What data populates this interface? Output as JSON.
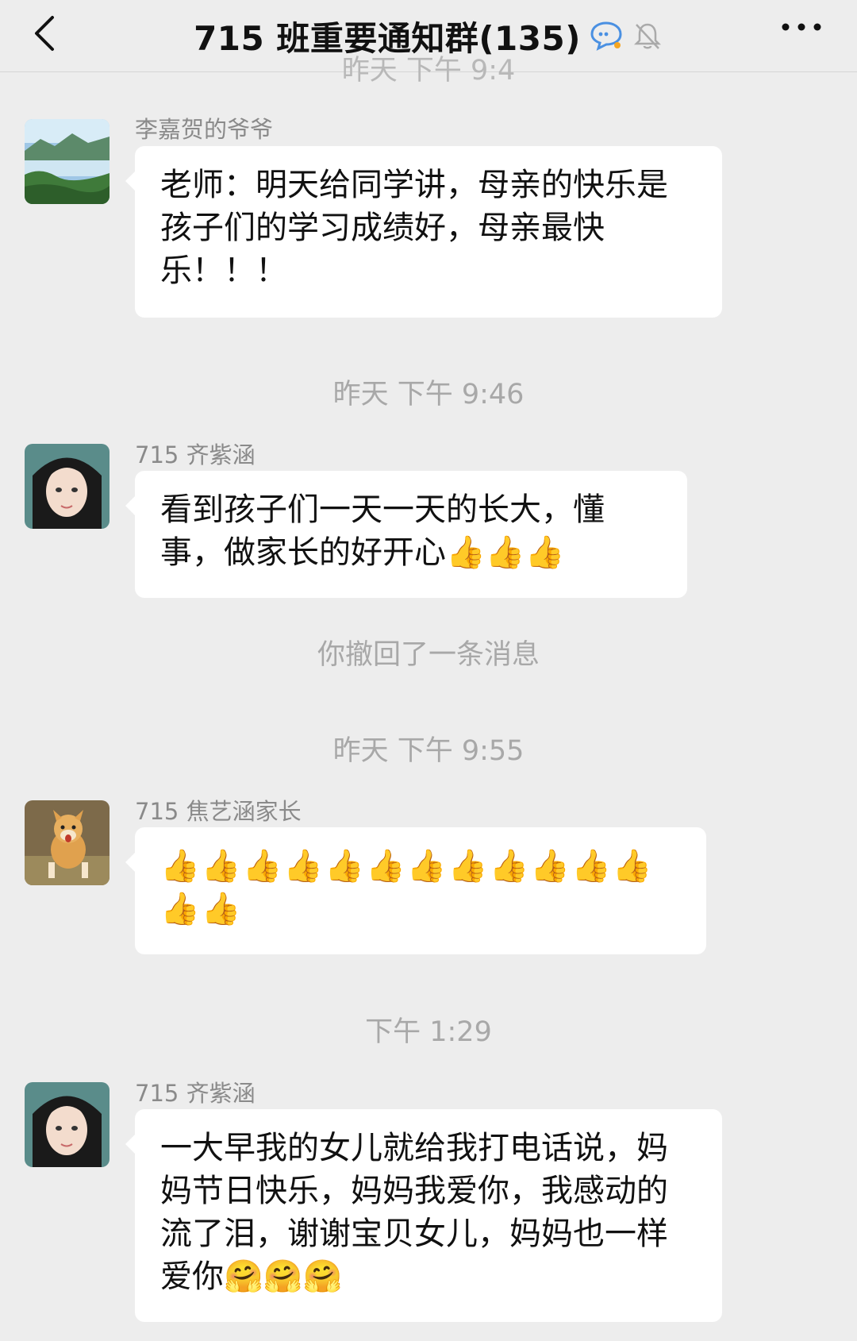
{
  "header": {
    "title": "715 班重要通知群(135)",
    "back_icon": "chevron-left-icon",
    "more_icon": "more-dots-icon",
    "chat_icon": "chat-bubble-icon",
    "mute_icon": "bell-off-icon"
  },
  "timestamps": {
    "top_peek": "昨天 下午 9:4",
    "t1": "昨天 下午 9:46",
    "recall": "你撤回了一条消息",
    "t2": "昨天 下午 9:55",
    "t3": "下午 1:29"
  },
  "messages": [
    {
      "sender": "李嘉贺的爷爷",
      "text": "老师：明天给同学讲，母亲的快乐是孩子们的学习成绩好，母亲最快乐！！！"
    },
    {
      "sender": "715 齐紫涵",
      "text": "看到孩子们一天一天的长大，懂事，做家长的好开心👍👍👍"
    },
    {
      "sender": "715 焦艺涵家长",
      "text": "👍👍👍👍👍👍👍👍👍👍👍👍👍👍"
    },
    {
      "sender": "715 齐紫涵",
      "text": "一大早我的女儿就给我打电话说，妈妈节日快乐，妈妈我爱你，我感动的流了泪，谢谢宝贝女儿，妈妈也一样爱你🤗🤗🤗"
    }
  ],
  "colors": {
    "background": "#ededed",
    "bubble": "#ffffff",
    "timestamp": "#a8a8a8",
    "sender": "#8a8a8a"
  }
}
